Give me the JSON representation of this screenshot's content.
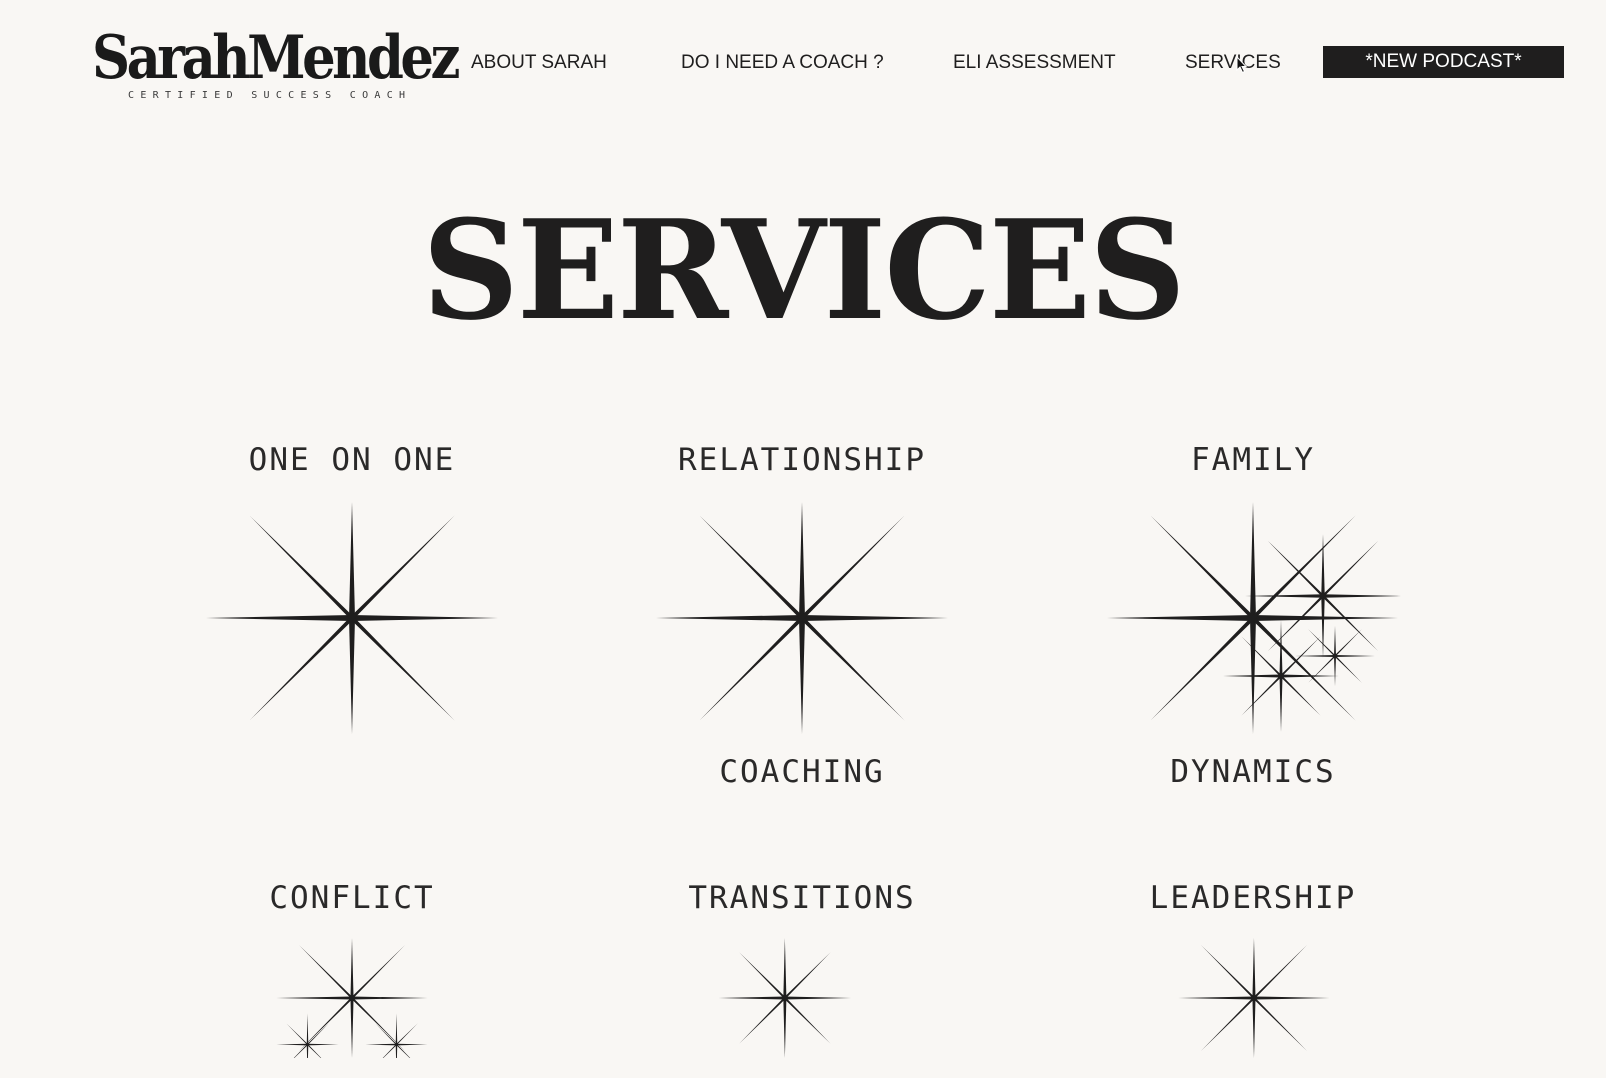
{
  "brand": {
    "name": "SarahMendez",
    "tagline": "CERTIFIED SUCCESS COACH"
  },
  "nav": {
    "items": [
      {
        "label": "ABOUT SARAH"
      },
      {
        "label": "DO I NEED A COACH ?"
      },
      {
        "label": "ELI ASSESSMENT"
      },
      {
        "label": "SERVICES"
      }
    ],
    "cta_label": "*NEW PODCAST*"
  },
  "page": {
    "title": "SERVICES"
  },
  "services": [
    {
      "title": "ONE ON ONE",
      "subtitle": "",
      "icon": "sparkle-icon"
    },
    {
      "title": "RELATIONSHIP",
      "subtitle": "COACHING",
      "icon": "sparkle-icon"
    },
    {
      "title": "FAMILY",
      "subtitle": "DYNAMICS",
      "icon": "sparkle-cluster-icon"
    },
    {
      "title": "CONFLICT",
      "subtitle": "",
      "icon": "sparkle-cluster-icon"
    },
    {
      "title": "TRANSITIONS",
      "subtitle": "",
      "icon": "sparkle-icon"
    },
    {
      "title": "LEADERSHIP",
      "subtitle": "",
      "icon": "sparkle-icon"
    }
  ],
  "colors": {
    "background": "#f9f7f4",
    "ink": "#1f1e1e",
    "button_text": "#ffffff"
  }
}
